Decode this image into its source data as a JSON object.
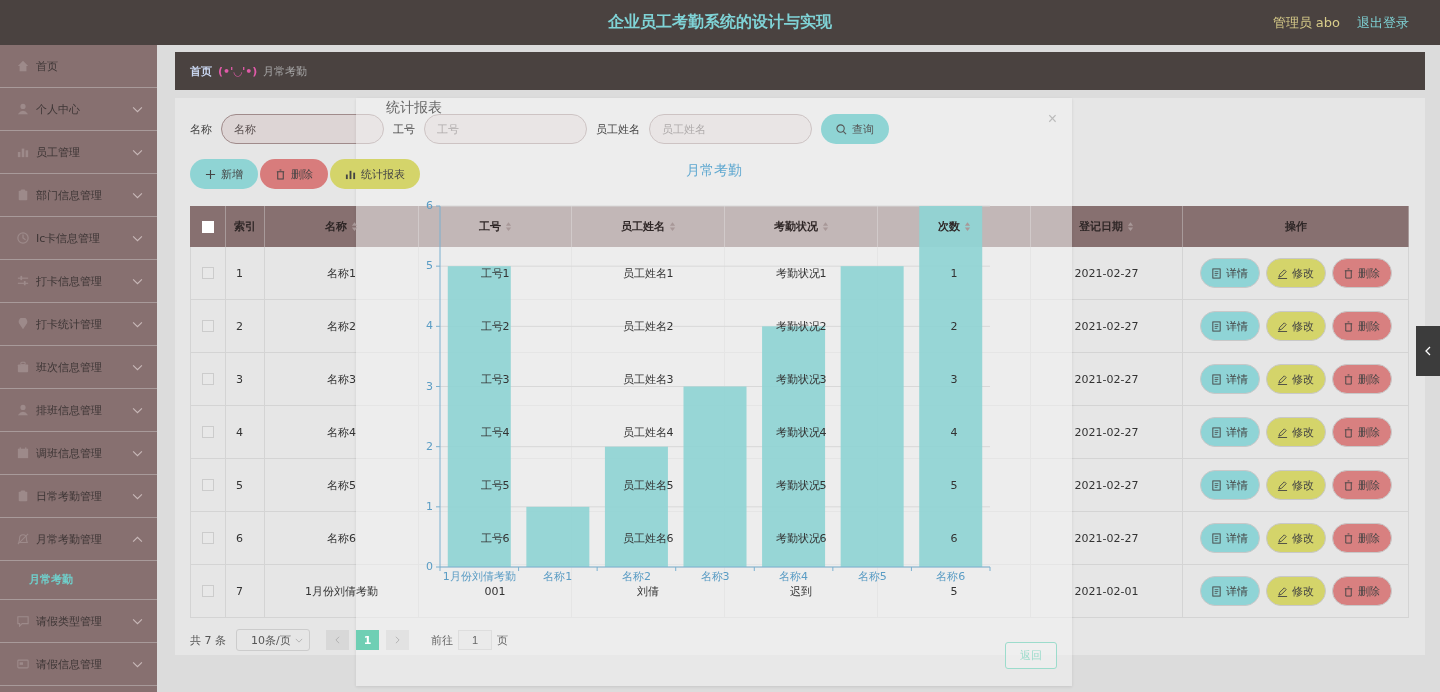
{
  "header": {
    "title": "企业员工考勤系统的设计与实现",
    "user": "管理员 abo",
    "logout": "退出登录"
  },
  "sidebar": {
    "items": [
      {
        "label": "首页",
        "kind": "link"
      },
      {
        "label": "个人中心",
        "kind": "menu",
        "expanded": false
      },
      {
        "label": "员工管理",
        "kind": "menu",
        "expanded": false
      },
      {
        "label": "部门信息管理",
        "kind": "menu",
        "expanded": false
      },
      {
        "label": "Ic卡信息管理",
        "kind": "menu",
        "expanded": false
      },
      {
        "label": "打卡信息管理",
        "kind": "menu",
        "expanded": false
      },
      {
        "label": "打卡统计管理",
        "kind": "menu",
        "expanded": false
      },
      {
        "label": "班次信息管理",
        "kind": "menu",
        "expanded": false
      },
      {
        "label": "排班信息管理",
        "kind": "menu",
        "expanded": false
      },
      {
        "label": "调班信息管理",
        "kind": "menu",
        "expanded": false
      },
      {
        "label": "日常考勤管理",
        "kind": "menu",
        "expanded": false
      },
      {
        "label": "月常考勤管理",
        "kind": "menu",
        "expanded": true,
        "children": [
          {
            "label": "月常考勤",
            "selected": true
          }
        ]
      },
      {
        "label": "请假类型管理",
        "kind": "menu",
        "expanded": false
      },
      {
        "label": "请假信息管理",
        "kind": "menu",
        "expanded": false
      }
    ]
  },
  "breadcrumb": {
    "home": "首页",
    "emoticon": "(•'◡'•)",
    "current": "月常考勤"
  },
  "search": {
    "fields": [
      {
        "label": "名称",
        "placeholder": "名称"
      },
      {
        "label": "工号",
        "placeholder": "工号"
      },
      {
        "label": "员工姓名",
        "placeholder": "员工姓名"
      }
    ],
    "button": "查询"
  },
  "toolbar": [
    {
      "kind": "add",
      "label": "新增"
    },
    {
      "kind": "delete",
      "label": "删除"
    },
    {
      "kind": "report",
      "label": "统计报表"
    }
  ],
  "table": {
    "select_all": {
      "checked": false
    },
    "columns": [
      {
        "label": "索引",
        "sortable": false
      },
      {
        "label": "名称",
        "sortable": true
      },
      {
        "label": "工号",
        "sortable": true
      },
      {
        "label": "员工姓名",
        "sortable": true
      },
      {
        "label": "考勤状况",
        "sortable": true
      },
      {
        "label": "次数",
        "sortable": true
      },
      {
        "label": "登记日期",
        "sortable": true
      },
      {
        "label": "操作",
        "sortable": false
      }
    ],
    "rows": [
      {
        "checked": false,
        "cells": [
          "1",
          "名称1",
          "工号1",
          "员工姓名1",
          "考勤状况1",
          "1",
          "2021-02-27"
        ],
        "actions": [
          "详情",
          "修改",
          "删除"
        ]
      },
      {
        "checked": false,
        "cells": [
          "2",
          "名称2",
          "工号2",
          "员工姓名2",
          "考勤状况2",
          "2",
          "2021-02-27"
        ],
        "actions": [
          "详情",
          "修改",
          "删除"
        ]
      },
      {
        "checked": false,
        "cells": [
          "3",
          "名称3",
          "工号3",
          "员工姓名3",
          "考勤状况3",
          "3",
          "2021-02-27"
        ],
        "actions": [
          "详情",
          "修改",
          "删除"
        ]
      },
      {
        "checked": false,
        "cells": [
          "4",
          "名称4",
          "工号4",
          "员工姓名4",
          "考勤状况4",
          "4",
          "2021-02-27"
        ],
        "actions": [
          "详情",
          "修改",
          "删除"
        ]
      },
      {
        "checked": false,
        "cells": [
          "5",
          "名称5",
          "工号5",
          "员工姓名5",
          "考勤状况5",
          "5",
          "2021-02-27"
        ],
        "actions": [
          "详情",
          "修改",
          "删除"
        ]
      },
      {
        "checked": false,
        "cells": [
          "6",
          "名称6",
          "工号6",
          "员工姓名6",
          "考勤状况6",
          "6",
          "2021-02-27"
        ],
        "actions": [
          "详情",
          "修改",
          "删除"
        ]
      },
      {
        "checked": false,
        "cells": [
          "7",
          "1月份刘倩考勤",
          "001",
          "刘倩",
          "迟到",
          "5",
          "2021-02-01"
        ],
        "actions": [
          "详情",
          "修改",
          "删除"
        ]
      }
    ]
  },
  "pagination": {
    "total": "共 7 条",
    "page_size": "10条/页",
    "pages": [
      {
        "label": "1",
        "selected": true
      }
    ],
    "goto_label": "前往",
    "goto_value": "1",
    "goto_suffix": "页"
  },
  "dialog": {
    "title": "统计报表",
    "close": "×",
    "back": "返回",
    "chart_data": {
      "type": "bar",
      "title": "月常考勤",
      "categories": [
        "1月份刘倩考勤",
        "名称1",
        "名称2",
        "名称3",
        "名称4",
        "名称5",
        "名称6"
      ],
      "series": [
        {
          "color": "#8fd4d4",
          "values": [
            5,
            1,
            2,
            3,
            4,
            5,
            6
          ]
        }
      ],
      "ylim": [
        0,
        6
      ],
      "yticks": [
        0,
        1,
        2,
        3,
        4,
        5,
        6
      ],
      "grid": true
    }
  }
}
